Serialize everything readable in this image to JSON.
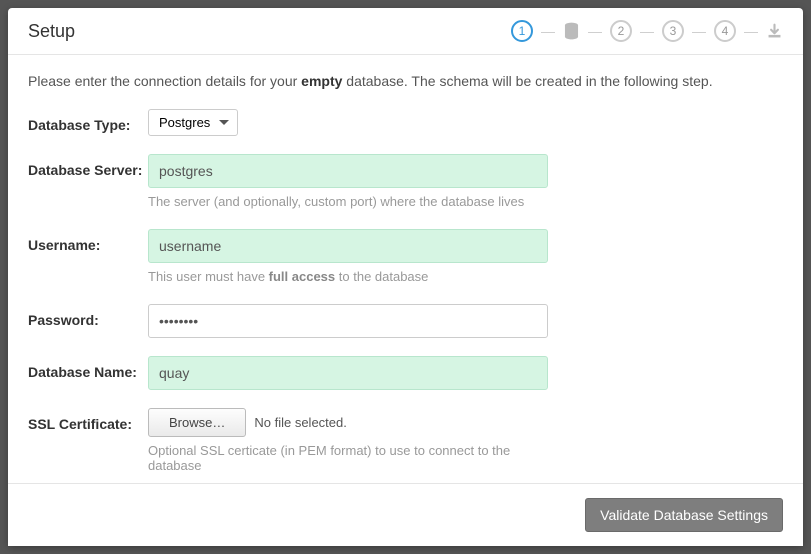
{
  "title": "Setup",
  "stepper": {
    "steps": [
      "1",
      "2",
      "3",
      "4"
    ]
  },
  "intro": {
    "pre": "Please enter the connection details for your ",
    "empty": "empty",
    "post": " database. The schema will be created in the following step."
  },
  "form": {
    "dbtype": {
      "label": "Database Type:",
      "value": "Postgres"
    },
    "server": {
      "label": "Database Server:",
      "value": "postgres",
      "hint": "The server (and optionally, custom port) where the database lives"
    },
    "username": {
      "label": "Username:",
      "value": "username",
      "hint_pre": "This user must have ",
      "hint_strong": "full access",
      "hint_post": " to the database"
    },
    "password": {
      "label": "Password:",
      "value": "••••••••"
    },
    "dbname": {
      "label": "Database Name:",
      "value": "quay"
    },
    "ssl": {
      "label": "SSL Certificate:",
      "browse": "Browse…",
      "status": "No file selected.",
      "hint": "Optional SSL certicate (in PEM format) to use to connect to the database"
    }
  },
  "footer": {
    "validate": "Validate Database Settings"
  }
}
